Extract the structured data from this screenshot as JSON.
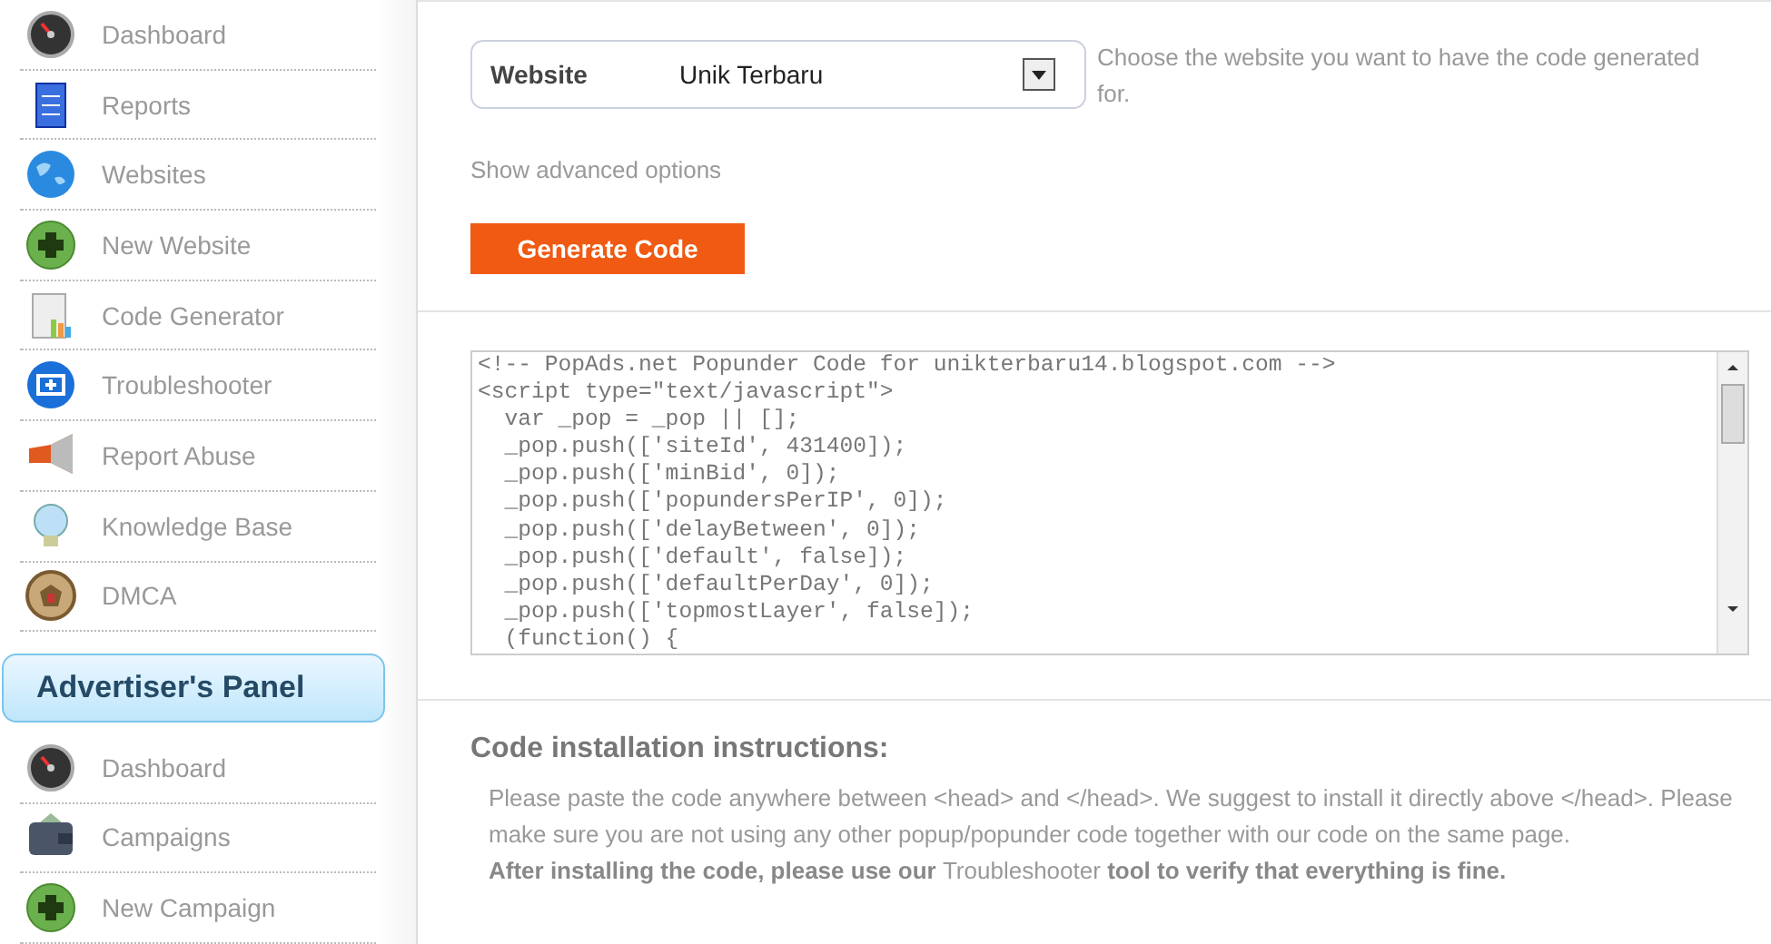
{
  "sidebar": {
    "publisher_items": [
      {
        "label": "Dashboard",
        "kind": "gauge"
      },
      {
        "label": "Reports",
        "kind": "report"
      },
      {
        "label": "Websites",
        "kind": "globe"
      },
      {
        "label": "New Website",
        "kind": "plus"
      },
      {
        "label": "Code Generator",
        "kind": "sheet"
      },
      {
        "label": "Troubleshooter",
        "kind": "kit"
      },
      {
        "label": "Report Abuse",
        "kind": "megaphone"
      },
      {
        "label": "Knowledge Base",
        "kind": "bulb"
      },
      {
        "label": "DMCA",
        "kind": "seal"
      }
    ],
    "panel_title": "Advertiser's Panel",
    "advertiser_items": [
      {
        "label": "Dashboard",
        "kind": "gauge"
      },
      {
        "label": "Campaigns",
        "kind": "wallet"
      },
      {
        "label": "New Campaign",
        "kind": "plus"
      }
    ]
  },
  "form": {
    "website_label": "Website",
    "website_value": "Unik Terbaru",
    "website_hint": "Choose the website you want to have the code generated for.",
    "advanced_link": "Show advanced options",
    "generate_button": "Generate Code"
  },
  "code_lines": [
    "<!-- PopAds.net Popunder Code for unikterbaru14.blogspot.com -->",
    "<script type=\"text/javascript\">",
    "  var _pop = _pop || [];",
    "  _pop.push(['siteId', 431400]);",
    "  _pop.push(['minBid', 0]);",
    "  _pop.push(['popundersPerIP', 0]);",
    "  _pop.push(['delayBetween', 0]);",
    "  _pop.push(['default', false]);",
    "  _pop.push(['defaultPerDay', 0]);",
    "  _pop.push(['topmostLayer', false]);",
    "  (function() {"
  ],
  "instructions": {
    "title": "Code installation instructions:",
    "text": "Please paste the code anywhere between <head> and </head>. We suggest to install it directly above </head>. Please make sure you are not using any other popup/popunder code together with our code on the same page.",
    "note_before": "After installing the code, please use our",
    "note_link": "Troubleshooter",
    "note_after": "tool to verify that everything is fine."
  }
}
